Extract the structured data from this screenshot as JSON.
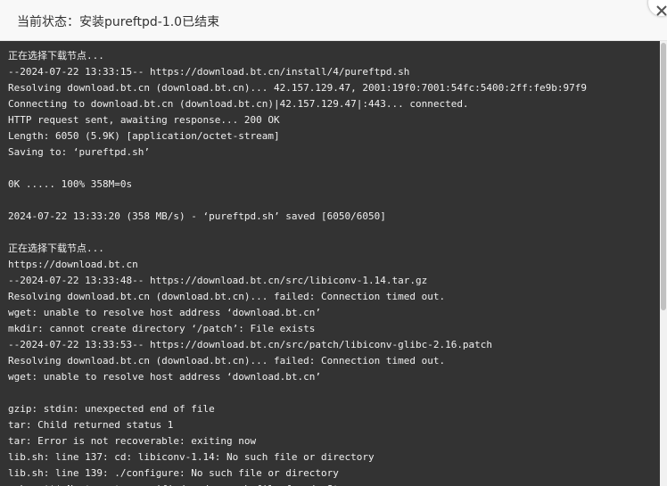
{
  "dialog": {
    "title": "当前状态：安装pureftpd-1.0已结束",
    "close_icon": "close-icon"
  },
  "log": {
    "lines": [
      "正在选择下载节点...",
      "--2024-07-22 13:33:15-- https://download.bt.cn/install/4/pureftpd.sh",
      "Resolving download.bt.cn (download.bt.cn)... 42.157.129.47, 2001:19f0:7001:54fc:5400:2ff:fe9b:97f9",
      "Connecting to download.bt.cn (download.bt.cn)|42.157.129.47|:443... connected.",
      "HTTP request sent, awaiting response... 200 OK",
      "Length: 6050 (5.9K) [application/octet-stream]",
      "Saving to: ‘pureftpd.sh’",
      "",
      "0K ..... 100% 358M=0s",
      "",
      "2024-07-22 13:33:20 (358 MB/s) - ‘pureftpd.sh’ saved [6050/6050]",
      "",
      "正在选择下载节点...",
      "https://download.bt.cn",
      "--2024-07-22 13:33:48-- https://download.bt.cn/src/libiconv-1.14.tar.gz",
      "Resolving download.bt.cn (download.bt.cn)... failed: Connection timed out.",
      "wget: unable to resolve host address ‘download.bt.cn’",
      "mkdir: cannot create directory ‘/patch’: File exists",
      "--2024-07-22 13:33:53-- https://download.bt.cn/src/patch/libiconv-glibc-2.16.patch",
      "Resolving download.bt.cn (download.bt.cn)... failed: Connection timed out.",
      "wget: unable to resolve host address ‘download.bt.cn’",
      "",
      "gzip: stdin: unexpected end of file",
      "tar: Child returned status 1",
      "tar: Error is not recoverable: exiting now",
      "lib.sh: line 137: cd: libiconv-1.14: No such file or directory",
      "lib.sh: line 139: ./configure: No such file or directory",
      "make: *** No targets specified and no makefile found. Stop."
    ]
  },
  "colors": {
    "terminal_bg": "#333333",
    "terminal_text": "#f0f0f0",
    "title_bg": "#f8f8f8"
  }
}
